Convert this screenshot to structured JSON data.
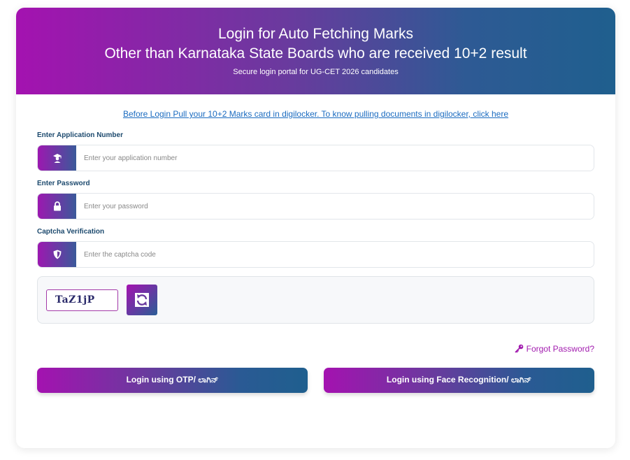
{
  "header": {
    "title_line1": "Login for Auto Fetching Marks",
    "title_line2": "Other than Karnataka State Boards who are received 10+2 result",
    "subtitle": "Secure login portal for UG-CET 2026 candidates"
  },
  "digilocker_link": "Before Login Pull your 10+2 Marks card in digilocker. To know pulling documents in digilocker, click here",
  "application": {
    "label": "Enter Application Number",
    "placeholder": "Enter your application number",
    "value": "",
    "icon": "graduate-icon"
  },
  "password": {
    "label": "Enter Password",
    "placeholder": "Enter your password",
    "value": "",
    "icon": "lock-icon"
  },
  "captcha": {
    "label": "Captcha Verification",
    "placeholder": "Enter the captcha code",
    "value": "",
    "icon": "shield-icon",
    "code": "TaZ1jP",
    "refresh_icon": "refresh-icon"
  },
  "forgot_password": "Forgot Password?",
  "buttons": {
    "otp": "Login using OTP/ ಲಾಗಿನ್",
    "face": "Login using Face Recognition/ ಲಾಗಿನ್"
  },
  "colors": {
    "brand_purple": "#a412b0",
    "brand_blue": "#1f5f8e",
    "link_blue": "#1a6bc0",
    "label_navy": "#1d4a6e"
  }
}
